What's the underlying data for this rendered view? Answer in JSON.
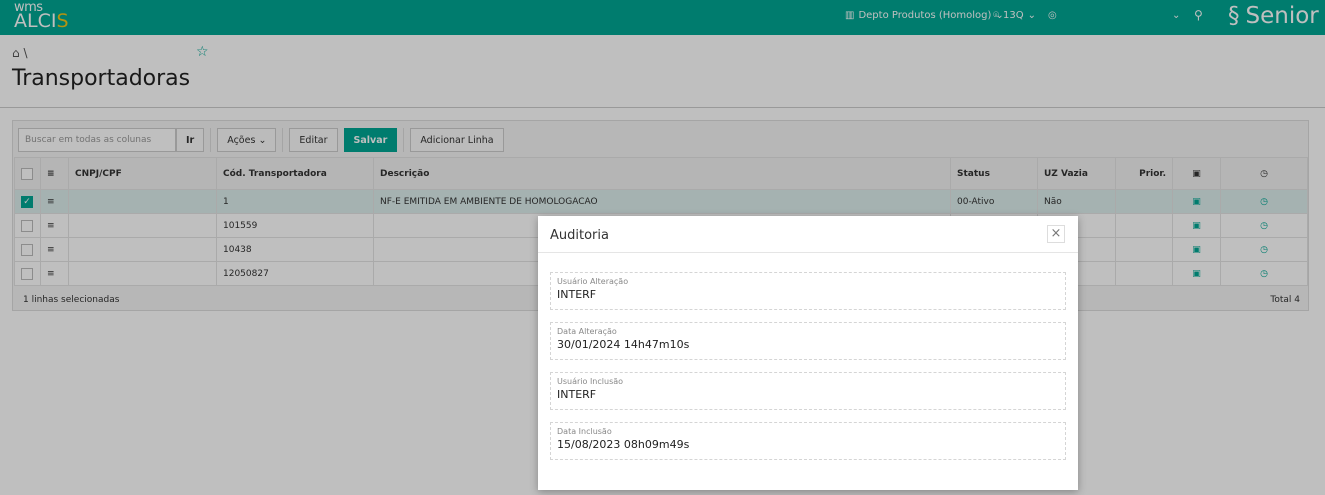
{
  "header": {
    "logo_top": "wms",
    "logo_main": "ALCI",
    "logo_accent": "S",
    "depot": "Depto Produtos (Homolog)",
    "location": "13Q",
    "user": "",
    "brand": "Senior"
  },
  "breadcrumb": {
    "separator": "\\"
  },
  "page": {
    "title": "Transportadoras"
  },
  "toolbar": {
    "search_placeholder": "Buscar em todas as colunas",
    "go": "Ir",
    "actions": "Ações",
    "edit": "Editar",
    "save": "Salvar",
    "add_row": "Adicionar Linha"
  },
  "table": {
    "columns": [
      "CNPJ/CPF",
      "Cód. Transportadora",
      "Descrição",
      "Status",
      "UZ Vazia",
      "Prior."
    ],
    "rows": [
      {
        "cnpj": "",
        "cod": "1",
        "desc": "NF-E EMITIDA EM AMBIENTE DE HOMOLOGACAO",
        "status": "00-Ativo",
        "uz": "Não",
        "prior": ""
      },
      {
        "cnpj": "",
        "cod": "101559",
        "desc": "",
        "status": "",
        "uz": "",
        "prior": ""
      },
      {
        "cnpj": "",
        "cod": "10438",
        "desc": "",
        "status": "",
        "uz": "",
        "prior": ""
      },
      {
        "cnpj": "",
        "cod": "12050827",
        "desc": "",
        "status": "",
        "uz": "",
        "prior": ""
      }
    ]
  },
  "footer": {
    "selected": "1 linhas selecionadas",
    "total": "Total 4"
  },
  "modal": {
    "title": "Auditoria",
    "fields": [
      {
        "label": "Usuário Alteração",
        "value": "INTERF"
      },
      {
        "label": "Data Alteração",
        "value": "30/01/2024 14h47m10s"
      },
      {
        "label": "Usuário Inclusão",
        "value": "INTERF"
      },
      {
        "label": "Data Inclusão",
        "value": "15/08/2023 08h09m49s"
      }
    ]
  }
}
